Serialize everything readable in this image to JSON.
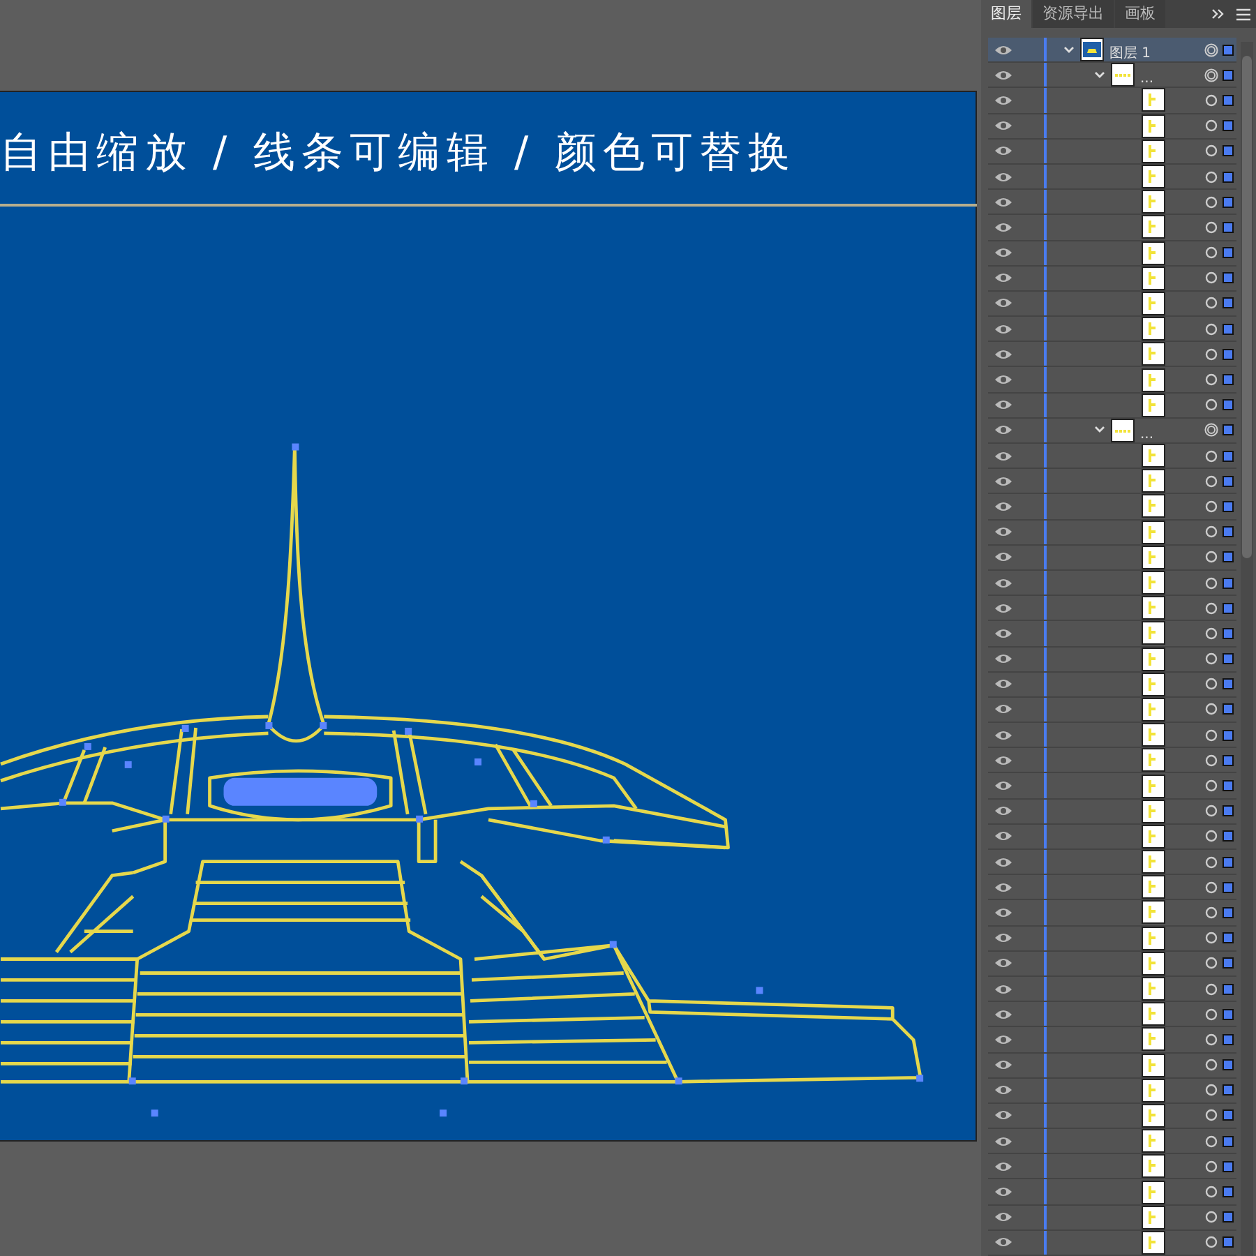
{
  "artboard": {
    "heading": "自由缩放 / 线条可编辑 / 颜色可替换"
  },
  "panel": {
    "tabs": [
      {
        "label": "图层",
        "selected": true
      },
      {
        "label": "资源导出",
        "selected": false
      },
      {
        "label": "画板",
        "selected": false
      }
    ],
    "layers": [
      {
        "name": "图层 1",
        "kind": "layer",
        "expanded": true,
        "selected": true,
        "children": [
          {
            "name": "...",
            "kind": "group",
            "expanded": true,
            "selected": false,
            "children": [
              {
                "kind": "path",
                "selected": false
              },
              {
                "kind": "path",
                "selected": false
              },
              {
                "kind": "path",
                "selected": false
              },
              {
                "kind": "path",
                "selected": false
              },
              {
                "kind": "path",
                "selected": false
              },
              {
                "kind": "path",
                "selected": false
              },
              {
                "kind": "path",
                "selected": false
              },
              {
                "kind": "path",
                "selected": false
              },
              {
                "kind": "path",
                "selected": false
              },
              {
                "kind": "path",
                "selected": false
              },
              {
                "kind": "path",
                "selected": false
              },
              {
                "kind": "path",
                "selected": false
              },
              {
                "kind": "path",
                "selected": false
              }
            ]
          },
          {
            "name": "...",
            "kind": "group",
            "expanded": true,
            "selected": false,
            "children": [
              {
                "kind": "path",
                "selected": false
              },
              {
                "kind": "path",
                "selected": false
              },
              {
                "kind": "path",
                "selected": false
              },
              {
                "kind": "path",
                "selected": false
              },
              {
                "kind": "path",
                "selected": false
              },
              {
                "kind": "path",
                "selected": false
              },
              {
                "kind": "path",
                "selected": false
              },
              {
                "kind": "path",
                "selected": false
              },
              {
                "kind": "path",
                "selected": false
              },
              {
                "kind": "path",
                "selected": false
              },
              {
                "kind": "path",
                "selected": false
              },
              {
                "kind": "path",
                "selected": false
              },
              {
                "kind": "path",
                "selected": false
              },
              {
                "kind": "path",
                "selected": false
              },
              {
                "kind": "path",
                "selected": false
              },
              {
                "kind": "path",
                "selected": false
              },
              {
                "kind": "path",
                "selected": false
              },
              {
                "kind": "path",
                "selected": false
              },
              {
                "kind": "path",
                "selected": false
              },
              {
                "kind": "path",
                "selected": false
              },
              {
                "kind": "path",
                "selected": false
              },
              {
                "kind": "path",
                "selected": false
              },
              {
                "kind": "path",
                "selected": false
              },
              {
                "kind": "path",
                "selected": false
              },
              {
                "kind": "path",
                "selected": false
              },
              {
                "kind": "path",
                "selected": false
              },
              {
                "kind": "path",
                "selected": false
              },
              {
                "kind": "path",
                "selected": false
              },
              {
                "kind": "path",
                "selected": false
              },
              {
                "kind": "path",
                "selected": false
              },
              {
                "kind": "path",
                "selected": false
              },
              {
                "kind": "path",
                "selected": false
              }
            ]
          }
        ]
      }
    ]
  }
}
